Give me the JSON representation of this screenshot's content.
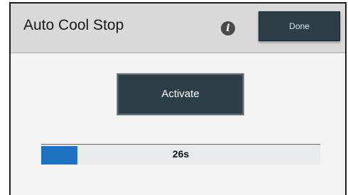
{
  "header": {
    "title": "Auto Cool Stop",
    "info_icon": "info-icon",
    "done_label": "Done"
  },
  "main": {
    "activate_label": "Activate"
  },
  "progress": {
    "label": "26s",
    "fraction": 0.13,
    "fill_color": "#1f72c0"
  }
}
